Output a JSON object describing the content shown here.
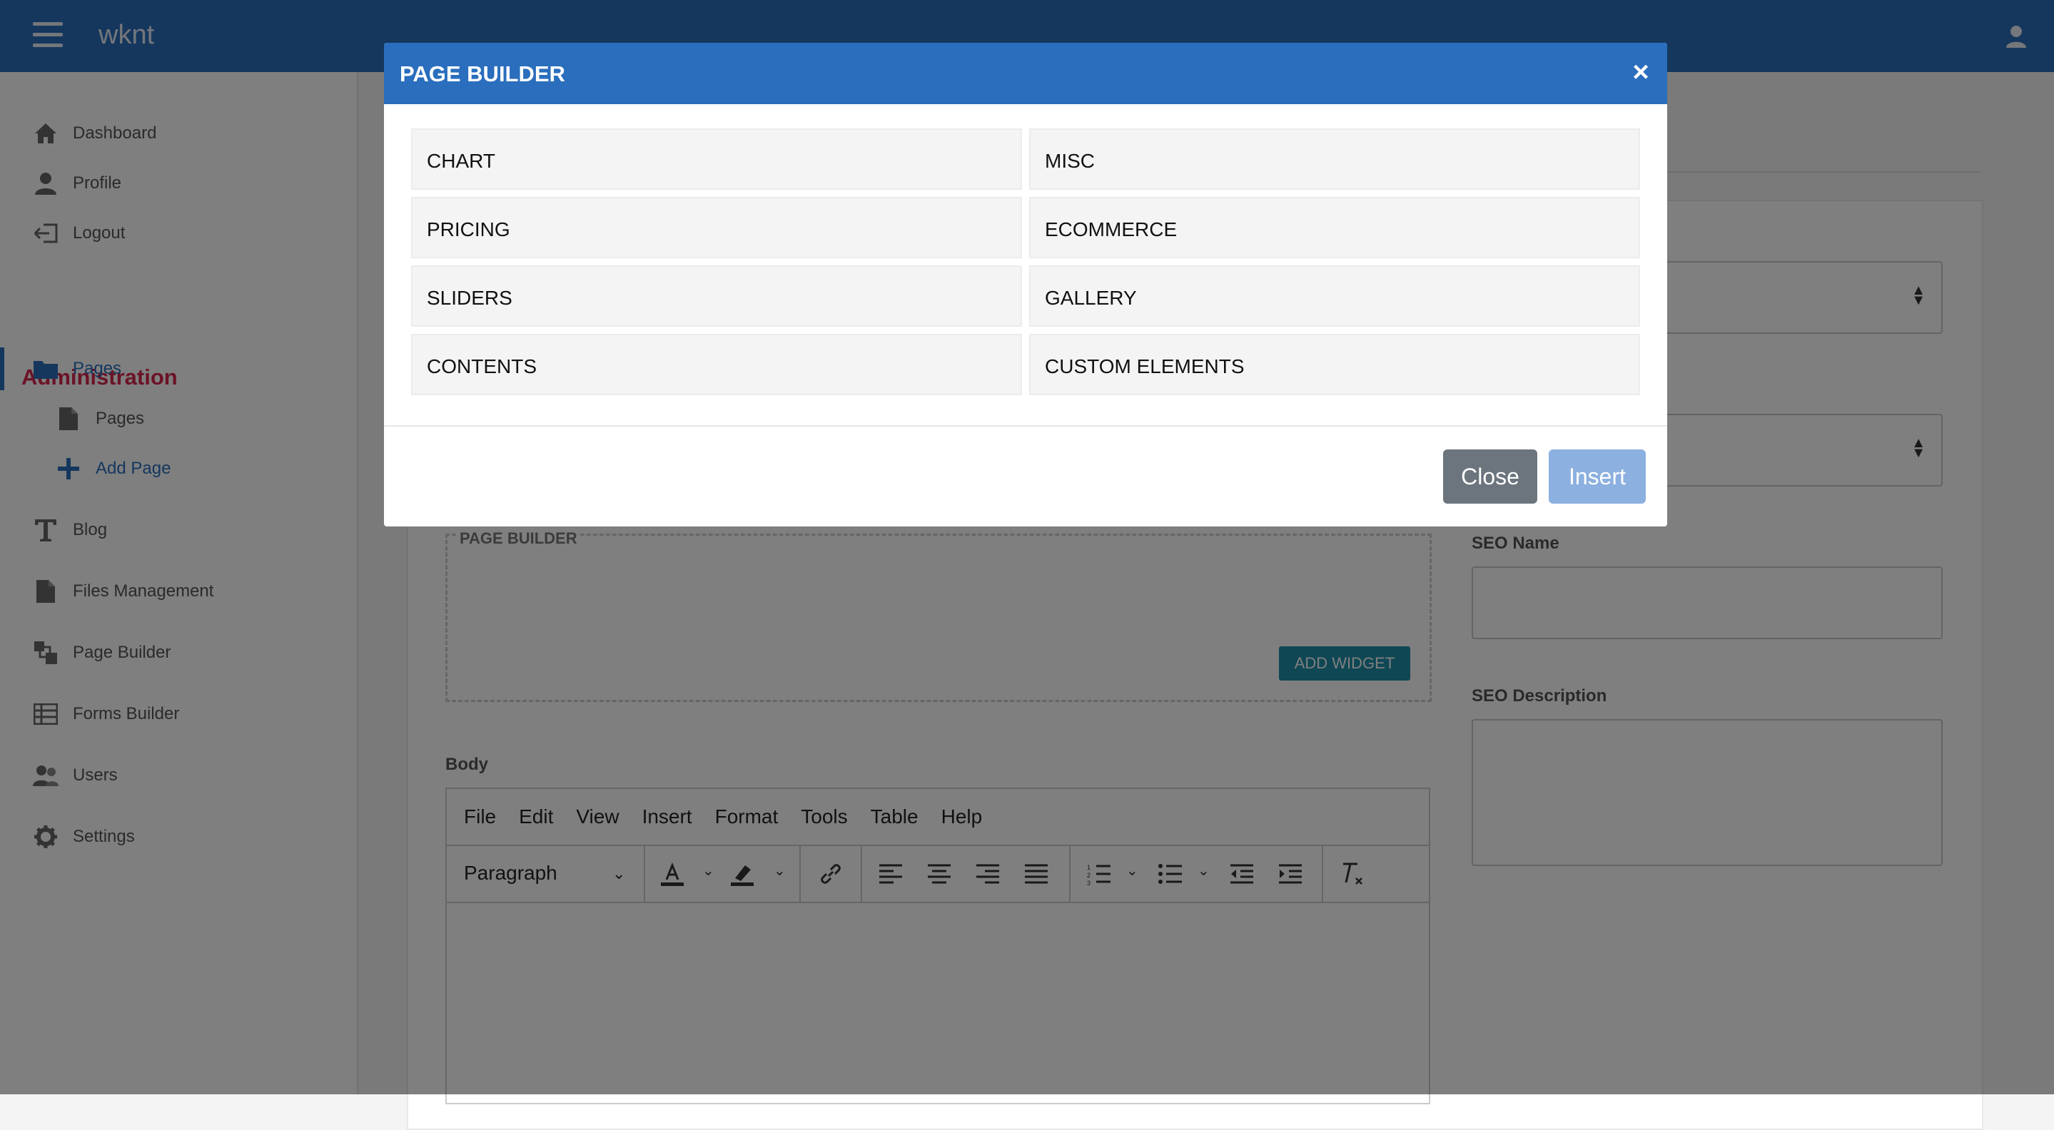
{
  "app": {
    "brand": "wknt"
  },
  "sidebar": {
    "items": [
      {
        "label": "Dashboard",
        "icon": "home-icon"
      },
      {
        "label": "Profile",
        "icon": "user-icon"
      },
      {
        "label": "Logout",
        "icon": "logout-icon"
      }
    ],
    "section_heading": "Administration",
    "admin_items": [
      {
        "label": "Pages",
        "icon": "folder-icon",
        "active": true
      },
      {
        "label": "Pages",
        "icon": "file-icon"
      },
      {
        "label": "Add Page",
        "icon": "plus-icon"
      },
      {
        "label": "Blog",
        "icon": "text-icon"
      },
      {
        "label": "Files Management",
        "icon": "file-icon"
      },
      {
        "label": "Page Builder",
        "icon": "layers-icon"
      },
      {
        "label": "Forms Builder",
        "icon": "table-icon"
      },
      {
        "label": "Users",
        "icon": "users-icon"
      },
      {
        "label": "Settings",
        "icon": "gear-icon"
      }
    ]
  },
  "form": {
    "page_builder_label": "PAGE BUILDER",
    "add_widget_label": "ADD WIDGET",
    "body_label": "Body",
    "seo_name_label": "SEO Name",
    "seo_description_label": "SEO Description"
  },
  "editor": {
    "menu": [
      "File",
      "Edit",
      "View",
      "Insert",
      "Format",
      "Tools",
      "Table",
      "Help"
    ],
    "block_format": "Paragraph"
  },
  "modal": {
    "title": "PAGE BUILDER",
    "close_glyph": "×",
    "categories": [
      "CHART",
      "MISC",
      "PRICING",
      "ECOMMERCE",
      "SLIDERS",
      "GALLERY",
      "CONTENTS",
      "CUSTOM ELEMENTS"
    ],
    "close_label": "Close",
    "insert_label": "Insert"
  },
  "colors": {
    "primary": "#2a6ebd",
    "admin_heading": "#d6274e",
    "add_widget": "#1f8ea8",
    "close_button": "#6c757d",
    "insert_button": "#8cb0e0"
  }
}
